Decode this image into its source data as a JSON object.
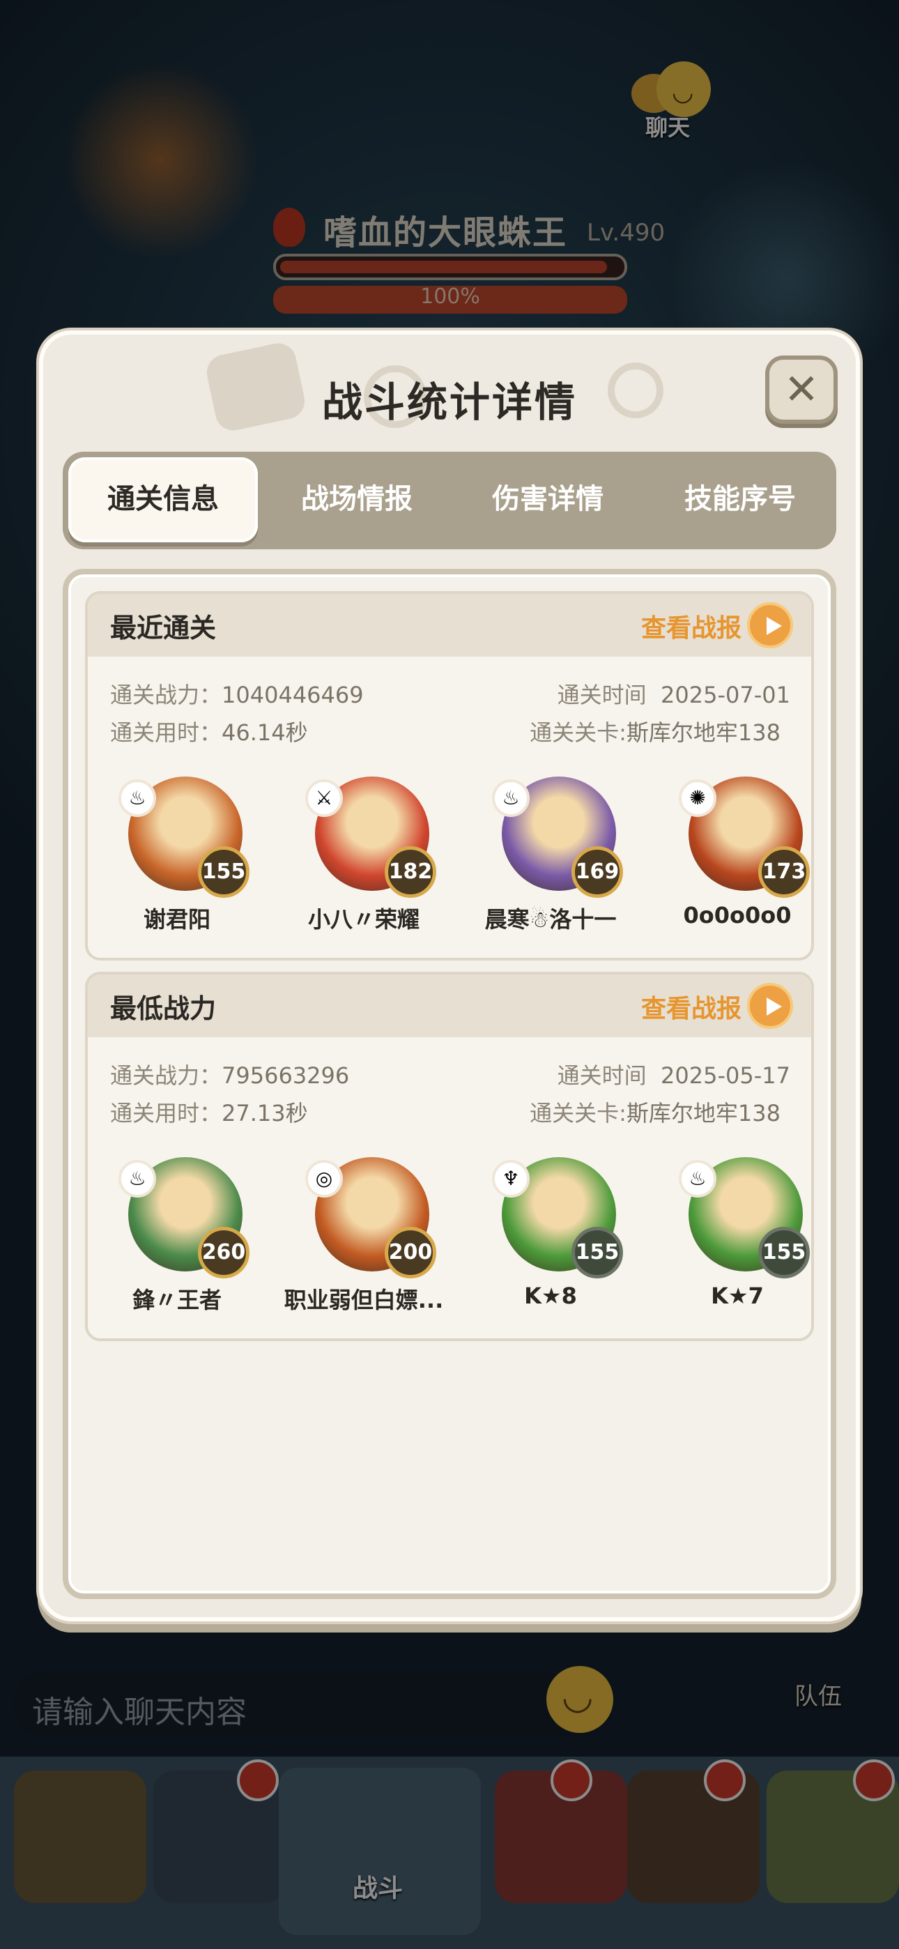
{
  "scene": {
    "chat_label": "聊天",
    "boss_name": "嗜血的大眼蛛王",
    "boss_level": "Lv.490",
    "boss_hp_percent": "100%",
    "boss_hp_fraction": 0.97,
    "chat_input_placeholder": "请输入聊天内容",
    "team_label": "队伍",
    "battle_tab_label": "战斗"
  },
  "modal": {
    "title": "战斗统计详情",
    "close_symbol": "✕",
    "tabs": [
      {
        "label": "通关信息",
        "active": true
      },
      {
        "label": "战场情报",
        "active": false
      },
      {
        "label": "伤害详情",
        "active": false
      },
      {
        "label": "技能序号",
        "active": false
      }
    ],
    "cards": [
      {
        "title": "最近通关",
        "link": "查看战报",
        "power_label": "通关战力：",
        "power_value": "1040446469",
        "time_label": "通关时间",
        "time_value": "2025-07-01",
        "duration_label": "通关用时：",
        "duration_value": "46.14秒",
        "stage_label": "通关关卡:",
        "stage_value": "斯库尔地牢138",
        "heroes": [
          {
            "name": "谢君阳",
            "level": "155",
            "element": "♨",
            "color": "#c8652a"
          },
          {
            "name": "小八〃荣耀",
            "level": "182",
            "element": "⚔",
            "color": "#d0452e"
          },
          {
            "name": "晨寒☃洛十一",
            "level": "169",
            "element": "♨",
            "color": "#7a5aa8"
          },
          {
            "name": "0o0o0o0",
            "level": "173",
            "element": "✺",
            "color": "#b8461e"
          }
        ]
      },
      {
        "title": "最低战力",
        "link": "查看战报",
        "power_label": "通关战力：",
        "power_value": "795663296",
        "time_label": "通关时间",
        "time_value": "2025-05-17",
        "duration_label": "通关用时：",
        "duration_value": "27.13秒",
        "stage_label": "通关关卡:",
        "stage_value": "斯库尔地牢138",
        "heroes": [
          {
            "name": "鋒〃王者",
            "level": "260",
            "element": "♨",
            "color": "#4a8a4a"
          },
          {
            "name": "职业弱但白嫖...",
            "level": "200",
            "element": "◎",
            "color": "#c25a22"
          },
          {
            "name": "K★8",
            "level": "155",
            "element": "♆",
            "color": "#4c9a3a"
          },
          {
            "name": "K★7",
            "level": "155",
            "element": "♨",
            "color": "#4c9a3a"
          }
        ]
      }
    ]
  }
}
